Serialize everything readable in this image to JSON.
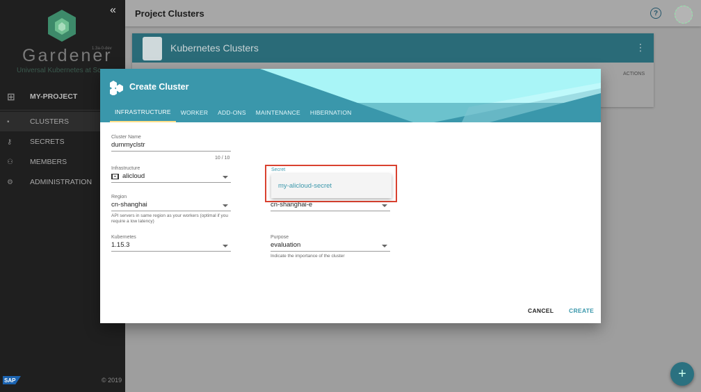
{
  "sidebar": {
    "brand": "Gardener",
    "version": "1.3a-0-dev",
    "tagline": "Universal Kubernetes at Sc",
    "project": "MY-PROJECT",
    "items": [
      {
        "label": "CLUSTERS",
        "icon": "clusters-icon"
      },
      {
        "label": "SECRETS",
        "icon": "key-icon"
      },
      {
        "label": "MEMBERS",
        "icon": "members-icon"
      },
      {
        "label": "ADMINISTRATION",
        "icon": "gear-icon"
      }
    ],
    "sap_logo": "SAP",
    "copyright": "© 2019"
  },
  "header": {
    "title": "Project Clusters",
    "help": "?"
  },
  "card": {
    "title": "Kubernetes Clusters",
    "actions_header": "ACTIONS"
  },
  "dialog": {
    "title": "Create Cluster",
    "tabs": [
      "INFRASTRUCTURE",
      "WORKER",
      "ADD-ONS",
      "MAINTENANCE",
      "HIBERNATION"
    ],
    "active_tab": "INFRASTRUCTURE",
    "fields": {
      "cluster_name": {
        "label": "Cluster Name",
        "value": "dummyclstr",
        "counter": "10 / 10"
      },
      "infrastructure": {
        "label": "Infrastructure",
        "value": "alicloud"
      },
      "region": {
        "label": "Region",
        "value": "cn-shanghai",
        "hint": "API servers in same region as your workers (optimal if you require a low latency)"
      },
      "kubernetes": {
        "label": "Kubernetes",
        "value": "1.15.3"
      },
      "secret": {
        "label": "Secret",
        "option": "my-alicloud-secret"
      },
      "zone": {
        "label": "Zone",
        "value": "cn-shanghai-e"
      },
      "purpose": {
        "label": "Purpose",
        "value": "evaluation",
        "hint": "Indicate the importance of the cluster"
      }
    },
    "cancel_label": "CANCEL",
    "create_label": "CREATE"
  },
  "colors": {
    "accent": "#3a97ab",
    "highlight_box": "#d9412f",
    "sidebar_bg": "#1f1f1f"
  }
}
